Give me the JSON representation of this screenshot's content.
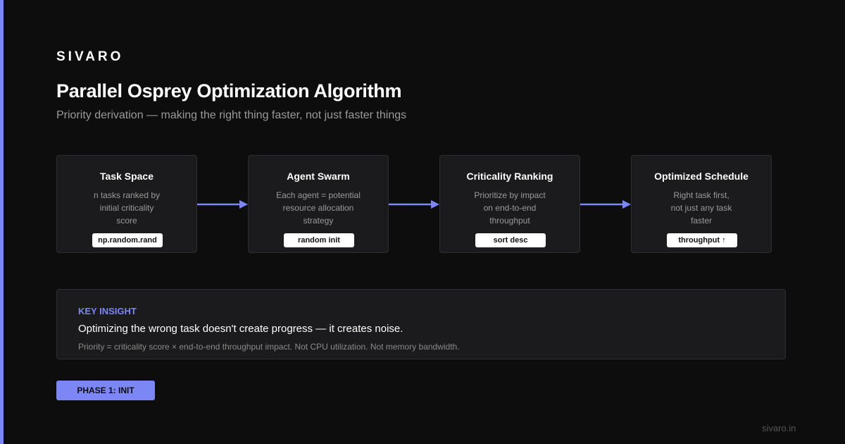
{
  "brand": "SIVARO",
  "title": "Parallel Osprey Optimization Algorithm",
  "subtitle": "Priority derivation — making the right thing faster, not just faster things",
  "colors": {
    "accent": "#7c86f5",
    "background": "#0d0d0d",
    "card": "#1b1b1d"
  },
  "steps": [
    {
      "title": "Task Space",
      "desc": [
        "n tasks ranked by",
        "initial criticality",
        "score"
      ],
      "tag": "np.random.rand"
    },
    {
      "title": "Agent Swarm",
      "desc": [
        "Each agent = potential",
        "resource allocation",
        "strategy"
      ],
      "tag": "random init"
    },
    {
      "title": "Criticality Ranking",
      "desc": [
        "Prioritize by impact",
        "on end-to-end",
        "throughput"
      ],
      "tag": "sort desc"
    },
    {
      "title": "Optimized Schedule",
      "desc": [
        "Right task first,",
        "not just any task",
        "faster"
      ],
      "tag": "throughput ↑"
    }
  ],
  "insight": {
    "label": "KEY INSIGHT",
    "main": "Optimizing the wrong task doesn't create progress — it creates noise.",
    "note": "Priority = criticality score × end-to-end throughput impact. Not CPU utilization. Not memory bandwidth."
  },
  "phase_label": "PHASE 1: INIT",
  "footer": "sivaro.in"
}
